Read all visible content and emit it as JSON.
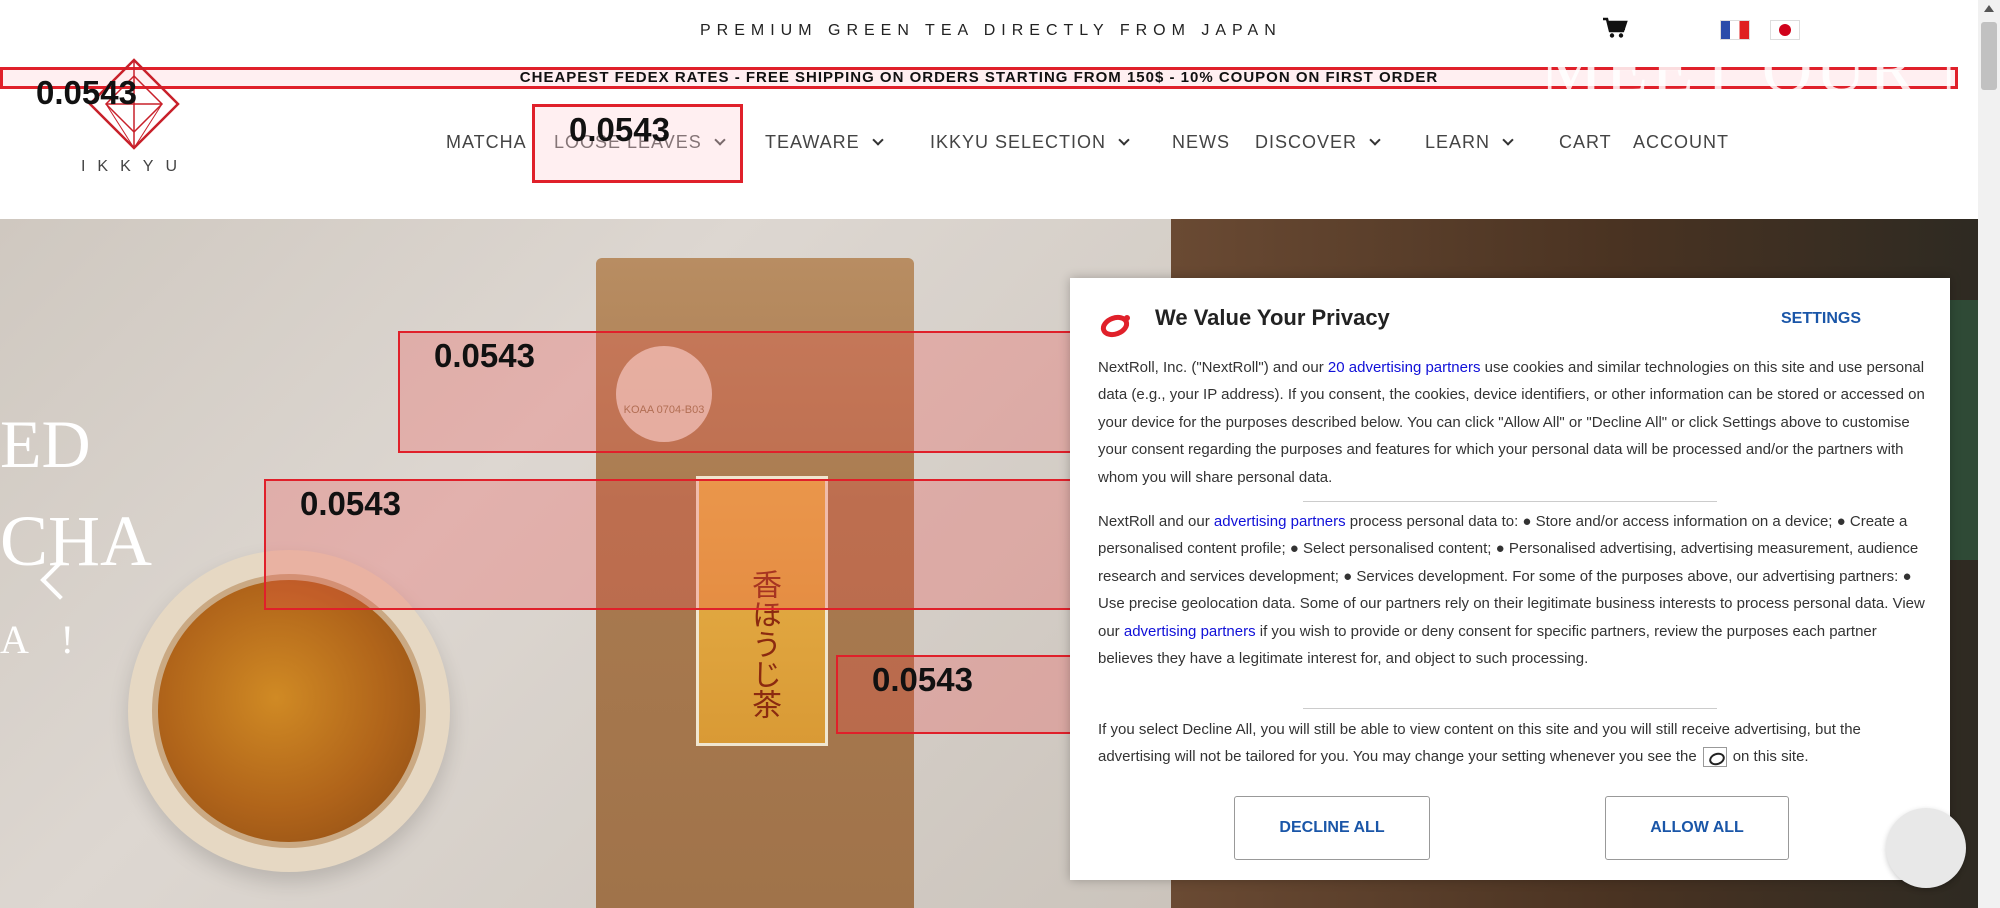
{
  "topbar": {
    "tagline": "PREMIUM GREEN TEA DIRECTLY FROM JAPAN",
    "cart_icon": "cart-icon",
    "flags": [
      "french-flag-icon",
      "japanese-flag-icon"
    ]
  },
  "shipping_banner": "CHEAPEST FEDEX RATES - FREE SHIPPING ON ORDERS STARTING FROM 150$ - 10% COUPON ON FIRST ORDER",
  "logo": {
    "text": "IKKYU"
  },
  "nav": {
    "matcha": "MATCHA",
    "loose_leaves": "LOOSE LEAVES",
    "teaware": "TEAWARE",
    "ikkyu_selection": "IKKYU SELECTION",
    "news": "NEWS",
    "discover": "DISCOVER",
    "learn": "LEARN",
    "cart": "CART",
    "account": "ACCOUNT"
  },
  "hero": {
    "line1": "ED",
    "line2": "CHA",
    "line3": "A !",
    "right_heading": "MEET OUR N",
    "package_seal": "KOAA\n0704-B03",
    "package_label": "香ほうじ茶"
  },
  "overlay_scores": {
    "ship_banner": "0.0543",
    "nav_loose_leaves": "0.0543",
    "hero_box_1": "0.0543",
    "hero_box_2": "0.0543",
    "hero_box_3": "0.0543"
  },
  "privacy_modal": {
    "title": "We Value Your Privacy",
    "settings_label": "SETTINGS",
    "p1_before": "NextRoll, Inc. (\"NextRoll\") and our ",
    "p1_link": "20 advertising partners",
    "p1_after": " use cookies and similar technologies on this site and use personal data (e.g., your IP address). If you consent, the cookies, device identifiers, or other information can be stored or accessed on your device for the purposes described below. You can click \"Allow All\" or \"Decline All\" or click Settings above to customise your consent regarding the purposes and features for which your personal data will be processed and/or the partners with whom you will share personal data.",
    "p2_before": "NextRoll and our ",
    "p2_link1": "advertising partners",
    "p2_mid": " process personal data to: ● Store and/or access information on a device; ● Create a personalised content profile; ● Select personalised content; ● Personalised advertising, advertising measurement, audience research and services development; ● Services development. For some of the purposes above, our advertising partners: ● Use precise geolocation data. Some of our partners rely on their legitimate business interests to process personal data. View our ",
    "p2_link2": "advertising partners",
    "p2_after": " if you wish to provide or deny consent for specific partners, review the purposes each partner believes they have a legitimate interest for, and object to such processing.",
    "p3_before": "If you select Decline All, you will still be able to view content on this site and you will still receive advertising, but the advertising will not be tailored for you. You may change your setting whenever you see the",
    "p3_after": "on this site.",
    "decline_label": "DECLINE ALL",
    "allow_label": "ALLOW ALL"
  }
}
